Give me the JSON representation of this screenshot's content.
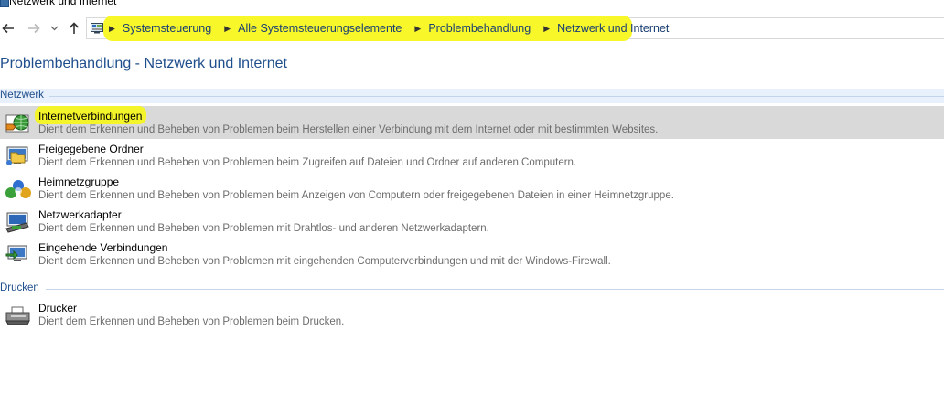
{
  "window": {
    "title": "Netzwerk und Internet"
  },
  "breadcrumb": [
    "Systemsteuerung",
    "Alle Systemsteuerungselemente",
    "Problembehandlung",
    "Netzwerk und Internet"
  ],
  "icons": {
    "back": "arrow-left-icon",
    "forward": "arrow-right-icon",
    "recent": "chevron-down-icon",
    "up": "arrow-up-icon",
    "address": "control-panel-icon"
  },
  "page": {
    "title": "Problembehandlung - Netzwerk und Internet"
  },
  "groups": [
    {
      "label": "Netzwerk",
      "items": [
        {
          "name": "Internetverbindungen",
          "description": "Dient dem Erkennen und Beheben von Problemen beim Herstellen einer Verbindung mit dem Internet oder mit bestimmten Websites.",
          "icon": "globe-network-icon",
          "selected": true
        },
        {
          "name": "Freigegebene Ordner",
          "description": "Dient dem Erkennen und Beheben von Problemen beim Zugreifen auf Dateien und Ordner auf anderen Computern.",
          "icon": "shared-folder-icon"
        },
        {
          "name": "Heimnetzgruppe",
          "description": "Dient dem Erkennen und Beheben von Problemen beim Anzeigen von Computern oder freigegebenen Dateien in einer Heimnetzgruppe.",
          "icon": "homegroup-icon"
        },
        {
          "name": "Netzwerkadapter",
          "description": "Dient dem Erkennen und Beheben von Problemen mit Drahtlos- und anderen Netzwerkadaptern.",
          "icon": "network-adapter-icon"
        },
        {
          "name": "Eingehende Verbindungen",
          "description": "Dient dem Erkennen und Beheben von Problemen mit eingehenden Computerverbindungen und mit der Windows-Firewall.",
          "icon": "incoming-connections-icon"
        }
      ]
    },
    {
      "label": "Drucken",
      "items": [
        {
          "name": "Drucker",
          "description": "Dient dem Erkennen und Beheben von Problemen beim Drucken.",
          "icon": "printer-icon"
        }
      ]
    }
  ],
  "colors": {
    "link": "#1e4e8c",
    "highlight": "#f7f72a",
    "selected_row": "#d9d9d9",
    "description": "#6d6d6d"
  }
}
